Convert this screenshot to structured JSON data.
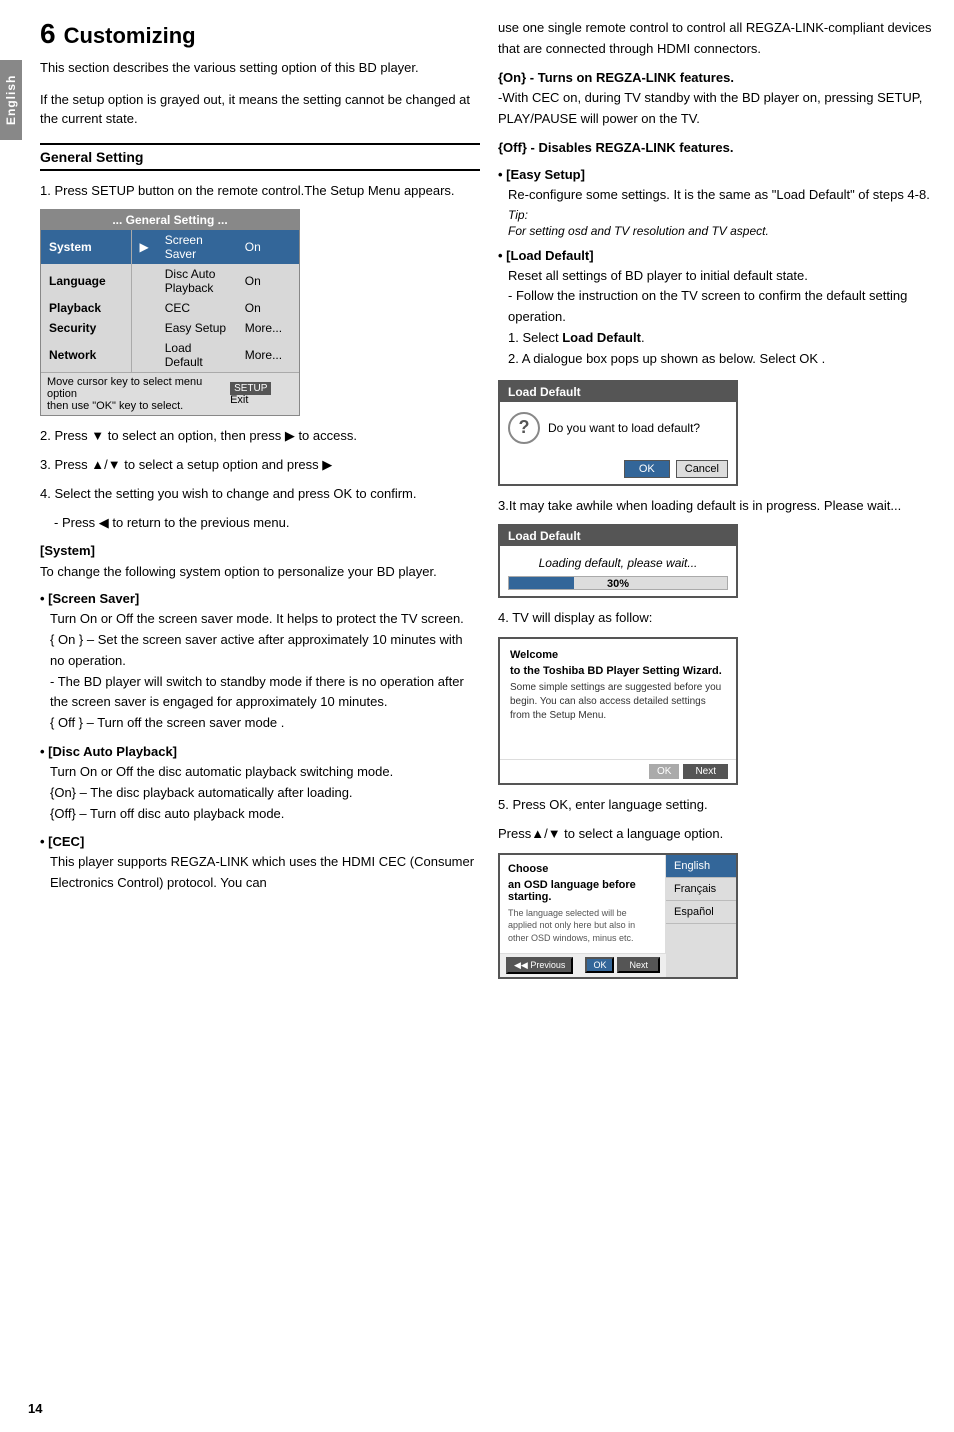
{
  "page": {
    "number": "14",
    "lang_tab": "English"
  },
  "chapter": {
    "number": "6",
    "title": "Customizing"
  },
  "intro": {
    "p1": "This section describes the various setting option of this BD player.",
    "p2": "If the setup option is grayed out, it means the setting cannot be changed at the current state."
  },
  "general_setting": {
    "section_title": "General Setting",
    "step1": "1. Press SETUP button on the remote control.The Setup Menu appears.",
    "menu_title": "... General Setting ...",
    "menu_rows": [
      {
        "label": "System",
        "submenu": "Screen Saver",
        "value": "On",
        "selected": true
      },
      {
        "label": "Language",
        "submenu": "Disc Auto Playback",
        "value": "On",
        "selected": false
      },
      {
        "label": "Playback",
        "submenu": "CEC",
        "value": "On",
        "selected": false
      },
      {
        "label": "Security",
        "submenu": "Easy Setup",
        "value": "More...",
        "selected": false
      },
      {
        "label": "Network",
        "submenu": "Load Default",
        "value": "More...",
        "selected": false
      }
    ],
    "menu_status": "Move cursor key to select menu option",
    "menu_status2": "then use \"OK\" key to select.",
    "menu_setup_btn": "SETUP",
    "menu_exit_btn": "Exit",
    "step2": "2. Press ▼ to select an option, then press ▶ to access.",
    "step3": "3. Press ▲/▼ to select a setup option and press ▶",
    "step4": "4. Select the setting you wish to change and press OK to confirm.",
    "step4b": "- Press ◀ to return to the previous menu.",
    "system_heading": "[System]",
    "system_desc": "To change the following system option to personalize your BD player.",
    "screen_saver_heading": "[Screen Saver]",
    "screen_saver_p1": "Turn On or Off the screen saver mode. It helps to protect the TV screen.",
    "screen_saver_p2": "{ On } – Set the screen saver active after approximately 10 minutes with no operation.",
    "screen_saver_p3": "- The BD player will switch to standby mode if there is no operation after the screen saver is engaged for approximately 10 minutes.",
    "screen_saver_p4": "{ Off } – Turn off the screen saver mode .",
    "disc_auto_heading": "[Disc Auto Playback]",
    "disc_auto_p1": "Turn On or Off the disc automatic playback switching mode.",
    "disc_auto_p2": "{On} – The disc playback automatically after loading.",
    "disc_auto_p3": "{Off} – Turn off disc auto playback mode.",
    "cec_heading": "[CEC]",
    "cec_p1": "This player supports REGZA-LINK which uses the HDMI CEC (Consumer Electronics Control) protocol. You can"
  },
  "right_col": {
    "cec_continued": "use one single remote control to control all REGZA-LINK-compliant devices that are connected through HDMI connectors.",
    "cec_on": "{On} - Turns on REGZA-LINK features.",
    "cec_on_detail": "-With CEC on, during TV standby with the BD player on, pressing SETUP, PLAY/PAUSE will  power on the TV.",
    "cec_off": "{Off} - Disables REGZA-LINK features.",
    "easy_setup_heading": "[Easy Setup]",
    "easy_setup_p1": "Re-configure some settings. It is the same as \"Load Default\" of steps 4-8.",
    "easy_setup_tip": "Tip:",
    "easy_setup_tip_text": "For setting osd and TV resolution and TV aspect.",
    "load_default_heading": "[Load Default]",
    "load_default_p1": "Reset all settings of BD player to initial default state.",
    "load_default_p2": "- Follow the instruction on the TV screen to confirm the default setting operation.",
    "load_default_step1": "1. Select Load Default.",
    "load_default_step2": "2. A dialogue box pops up shown as below. Select OK .",
    "dialog_title": "Load Default",
    "dialog_question": "Do you want to load default?",
    "dialog_ok": "OK",
    "dialog_cancel": "Cancel",
    "step3_text": "3.It may take awhile when loading default is in progress. Please wait...",
    "progress_dialog_title": "Load Default",
    "progress_loading_text": "Loading default, please wait...",
    "progress_percent": "30%",
    "step4_text": "4. TV will display as follow:",
    "wizard_title": "Welcome",
    "wizard_subtitle": "to the Toshiba BD Player Setting Wizard.",
    "wizard_text": "Some simple settings are suggested before you begin. You can also access detailed settings from the Setup Menu.",
    "wizard_ok": "OK",
    "wizard_next": "Next",
    "step5_text": "5. Press OK, enter language setting.",
    "step5_sub": "Press▲/▼ to select a language option.",
    "choose_title": "Choose",
    "choose_subtitle": "an OSD language before starting.",
    "choose_text": "The language selected will be applied not only here but also in other OSD windows, minus etc.",
    "lang_options": [
      "English",
      "Français",
      "Español"
    ],
    "lang_selected": "English",
    "lang_prev": "◀◀ Previous",
    "lang_ok": "OK",
    "lang_next": "Next"
  }
}
